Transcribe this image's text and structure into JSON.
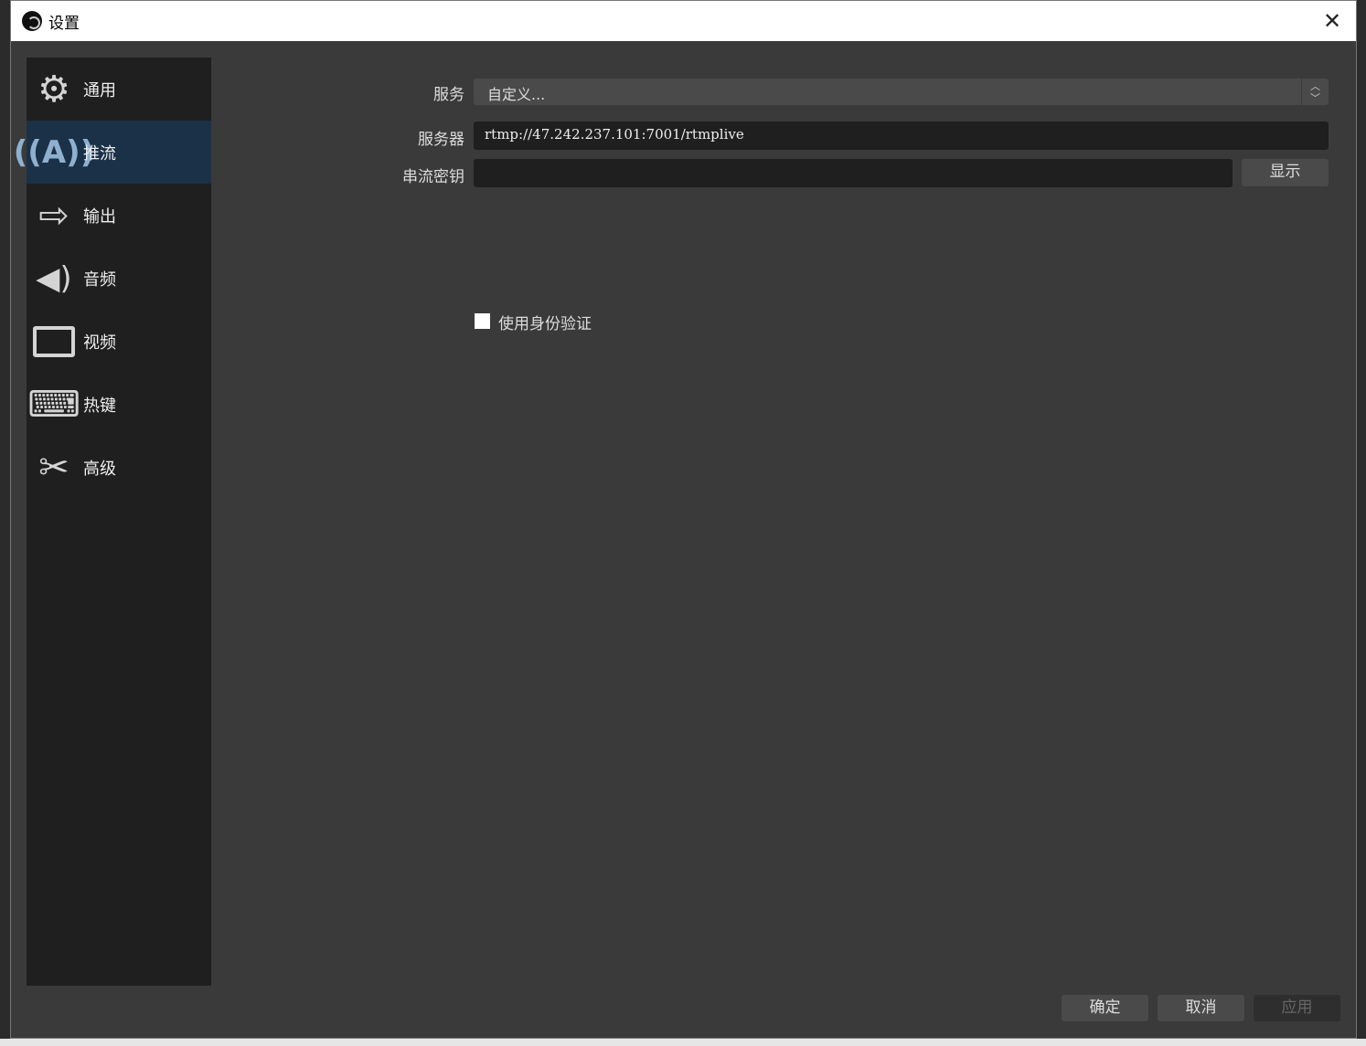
{
  "window": {
    "title": "设置",
    "close_icon": "close-icon"
  },
  "sidebar": {
    "items": [
      {
        "label": "通用",
        "icon": "gear-icon",
        "glyph": "⚙"
      },
      {
        "label": "推流",
        "icon": "broadcast-antenna-icon",
        "glyph": "📡"
      },
      {
        "label": "输出",
        "icon": "output-monitor-icon",
        "glyph": "⇨"
      },
      {
        "label": "音频",
        "icon": "speaker-icon",
        "glyph": "🔊"
      },
      {
        "label": "视频",
        "icon": "monitor-icon",
        "glyph": "🖵"
      },
      {
        "label": "热键",
        "icon": "keyboard-icon",
        "glyph": "⌨"
      },
      {
        "label": "高级",
        "icon": "tools-icon",
        "glyph": "✂"
      }
    ],
    "selected": "推流"
  },
  "stream": {
    "service_label": "服务",
    "service_value": "自定义...",
    "server_label": "服务器",
    "server_value": "rtmp://47.242.237.101:7001/rtmplive",
    "key_label": "串流密钥",
    "key_value": "",
    "show_label": "显示",
    "auth_label": "使用身份验证",
    "auth_checked": false
  },
  "footer": {
    "ok": "确定",
    "cancel": "取消",
    "apply": "应用"
  }
}
